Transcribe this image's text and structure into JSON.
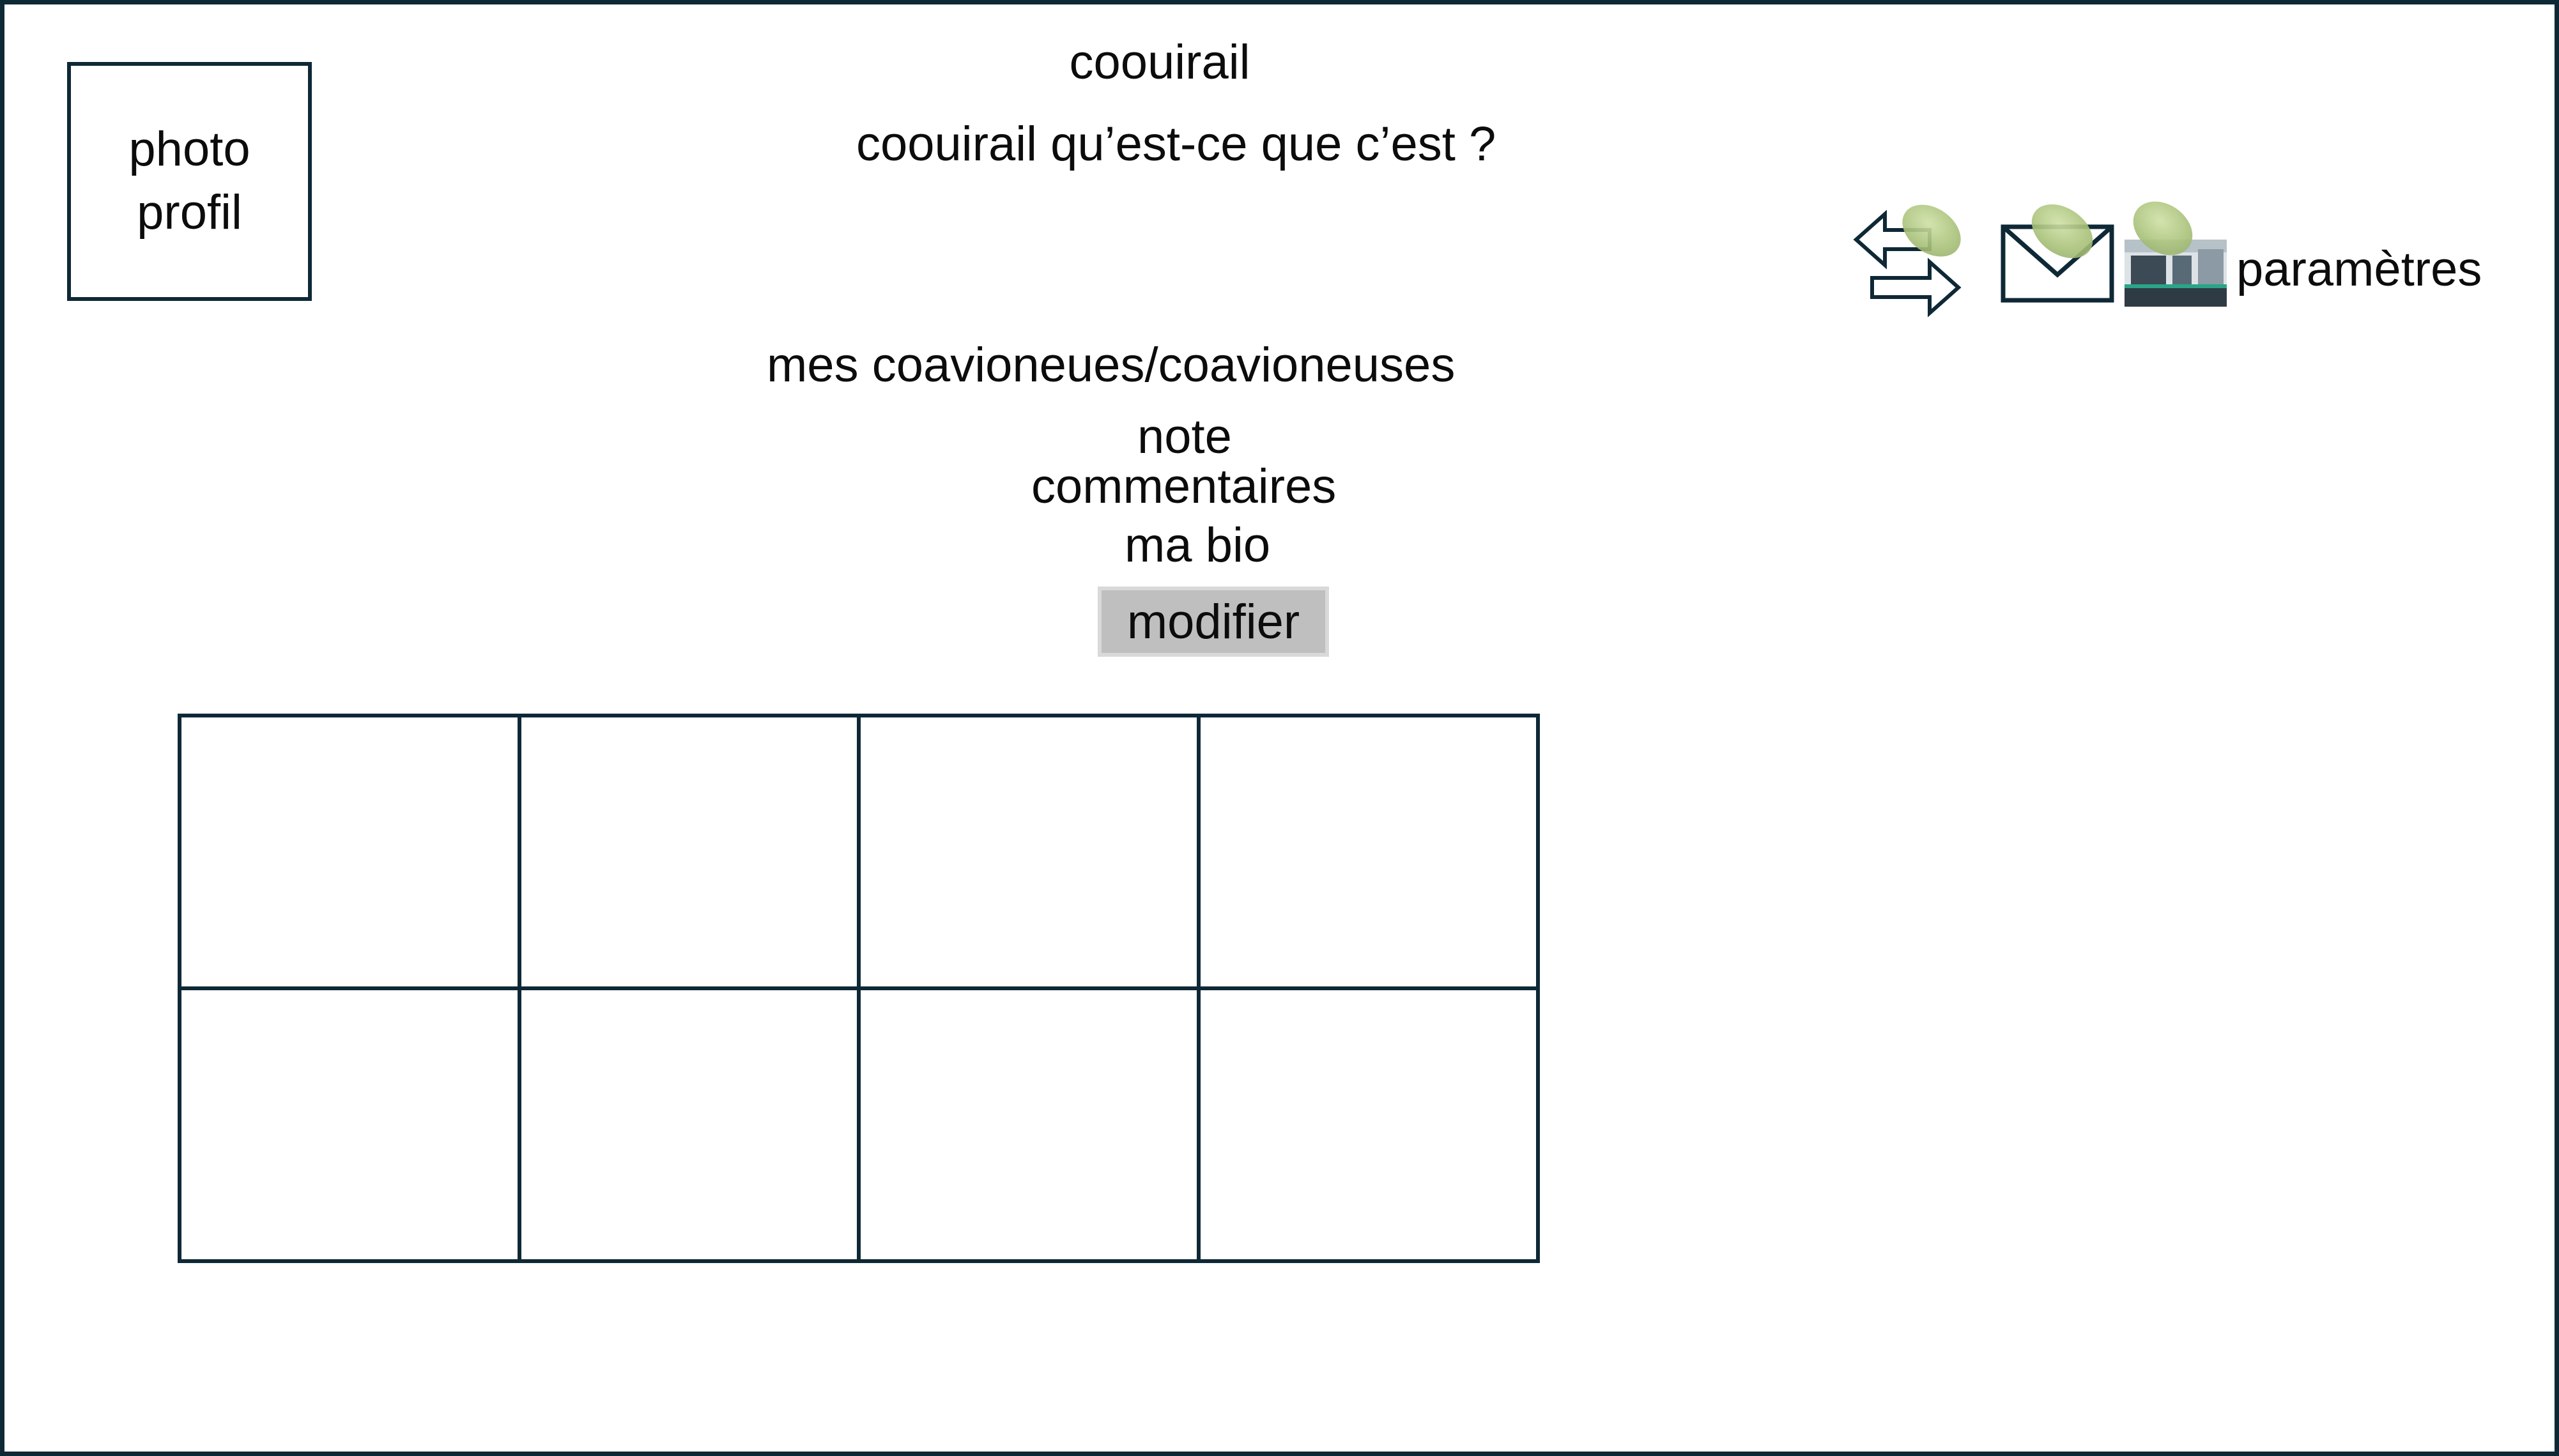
{
  "header": {
    "app_title": "coouirail",
    "about_link": "coouirail qu’est-ce que c’est ?"
  },
  "profile": {
    "photo_line1": "photo",
    "photo_line2": "profil",
    "section_title": "mes coavioneues/coavioneuses",
    "note_label": "note",
    "comments_label": "commentaires",
    "bio_label": "ma bio",
    "modify_button": "modifier"
  },
  "grid": {
    "rows": 2,
    "columns": 4
  },
  "toolbar": {
    "icons": [
      "swap-arrows-icon",
      "mail-icon",
      "train-icon"
    ],
    "settings_label": "paramètres"
  },
  "colors": {
    "border": "#0e2836",
    "button_bg": "#bfbfbf",
    "button_border": "#d9d9d9",
    "blob_green": "#a9c27a"
  }
}
